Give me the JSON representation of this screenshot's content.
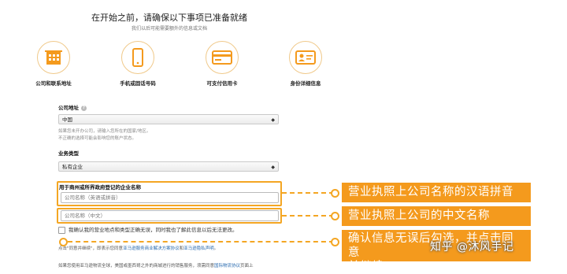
{
  "header": {
    "title": "在开始之前，请确保以下事项已准备就绪",
    "subtitle": "我们以后可能需要额外的信息或文档"
  },
  "requirements": [
    {
      "label": "公司和联系地址",
      "icon": "building-icon"
    },
    {
      "label": "手机或固话号码",
      "icon": "phone-icon"
    },
    {
      "label": "可支付信用卡",
      "icon": "credit-card-icon"
    },
    {
      "label": "身份详细信息",
      "icon": "id-card-icon"
    }
  ],
  "form": {
    "company_address_label": "公司地址",
    "help_glyph": "?",
    "country_value": "中国",
    "country_hint_1": "如果您未开办公司，请输入您所在的国家/地区。",
    "country_hint_2": "不正确的选择可能会影响您的账户状态。",
    "business_type_label": "业务类型",
    "business_type_value": "私有企业",
    "registered_name_label": "用于商州或所界政府登记的企业名称",
    "pinyin_placeholder": "公司名称（英语或拼音）",
    "chinese_placeholder": "公司名称（中文）",
    "confirm_text": "我确认我的营业地点和类型正确无误，同时我也了解此信息以后无法更改。",
    "legal_1_prefix": "点击\"同意并继续\"，即表示您同意",
    "legal_1_link1": "亚马逊服务商业解决方案协议",
    "legal_1_mid": "和",
    "legal_1_link2": "亚马逊隐私声明",
    "legal_1_suffix": "。",
    "legal_2_prefix": "如果您使用亚马逊物流全球，美国或墨西哥之外的商城进行的销售服务，须需同意",
    "legal_2_link": "国际物流协议",
    "legal_2_suffix": "页面上"
  },
  "callouts": {
    "pinyin": "营业执照上公司名称的汉语拼音",
    "chinese": "营业执照上公司的中文名称",
    "confirm_line1": "确认信息无误后勾选，并点击同意",
    "confirm_line2": "并继续"
  },
  "watermark": "知乎 @沐风手记",
  "colors": {
    "accent": "#f49a1d",
    "link": "#2b6cb0"
  }
}
